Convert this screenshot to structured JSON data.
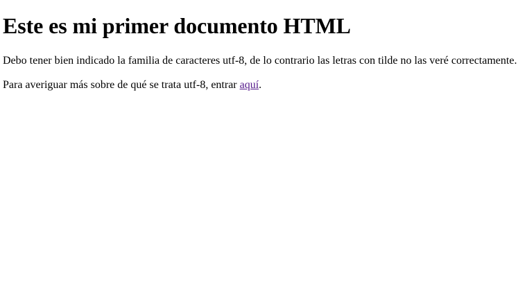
{
  "document": {
    "heading": "Este es mi primer documento HTML",
    "paragraph1": "Debo tener bien indicado la familia de caracteres utf-8, de lo contrario las letras con tilde no las veré correctamente.",
    "paragraph2_prefix": "Para averiguar más sobre de qué se trata utf-8, entrar ",
    "link_text": "aquí",
    "paragraph2_suffix": "."
  },
  "colors": {
    "text": "#000000",
    "visited_link": "#551a8b",
    "background": "#ffffff"
  }
}
